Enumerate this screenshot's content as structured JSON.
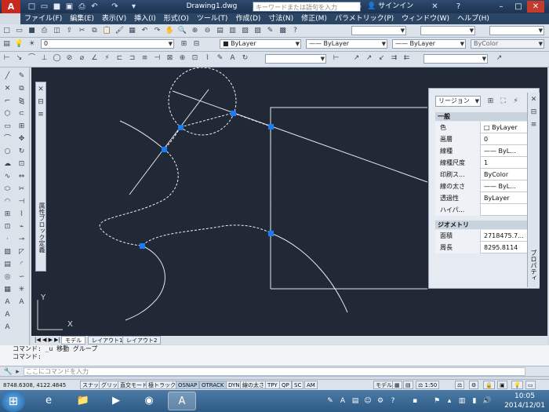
{
  "app": {
    "document_title": "Drawing1.dwg",
    "search_placeholder": "キーワードまたは語句を入力",
    "signin_label": "サインイン",
    "help_icon": "?"
  },
  "menu": [
    "ファイル(F)",
    "編集(E)",
    "表示(V)",
    "挿入(I)",
    "形式(O)",
    "ツール(T)",
    "作成(D)",
    "寸法(N)",
    "修正(M)",
    "パラメトリック(P)",
    "ウィンドウ(W)",
    "ヘルプ(H)"
  ],
  "toolbar": {
    "layer_value": "0",
    "color_value": "ByLayer",
    "linetype_value": "ByLayer",
    "lineweight_value": "ByLayer",
    "plotstyle_value": "ByColor"
  },
  "properties_palette": {
    "side_title": "プロパティ",
    "vertical_title": "属性ブロック定義",
    "selection": "リージョン",
    "general_header": "一般",
    "general_rows": [
      {
        "key": "色",
        "value": "ByLayer"
      },
      {
        "key": "画層",
        "value": "0"
      },
      {
        "key": "線種",
        "value": "—— ByL..."
      },
      {
        "key": "線種尺度",
        "value": "1"
      },
      {
        "key": "印刷ス...",
        "value": "ByColor"
      },
      {
        "key": "線の太さ",
        "value": "—— ByL..."
      },
      {
        "key": "透過性",
        "value": "ByLayer"
      },
      {
        "key": "ハイパ...",
        "value": ""
      }
    ],
    "geometry_header": "ジオメトリ",
    "geometry_rows": [
      {
        "key": "面積",
        "value": "2718475.7..."
      },
      {
        "key": "周長",
        "value": "8295.8114"
      }
    ]
  },
  "tabs": [
    "モデル",
    "レイアウト1",
    "レイアウト2"
  ],
  "command": {
    "history": [
      "コマンド:  _u 移動 グループ",
      "コマンド:"
    ],
    "placeholder": "ここにコマンドを入力"
  },
  "status": {
    "coordinates": "8748.6308, 4122.4845",
    "buttons": [
      "スナップ",
      "グリッド",
      "直交モード",
      "極トラック",
      "OSNAP",
      "OTRACK",
      "DYN",
      "線の太さ",
      "TPY",
      "QP",
      "SC",
      "AM"
    ],
    "on_buttons": [
      "OSNAP",
      "OTRACK"
    ],
    "model_label": "モデル",
    "scale_label": "1:50"
  },
  "taskbar": {
    "time": "10:05",
    "date": "2014/12/01",
    "language": "A"
  },
  "ucs": {
    "x": "X",
    "y": "Y"
  },
  "colors": {
    "canvas": "#212836",
    "grip": "#1f7bf2",
    "title": "#1d3352"
  }
}
